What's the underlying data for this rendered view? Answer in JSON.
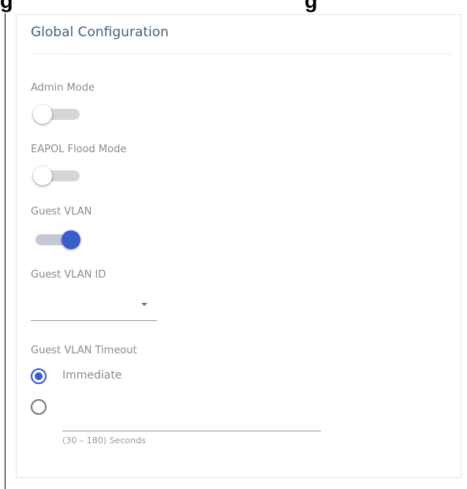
{
  "card": {
    "title": "Global Configuration"
  },
  "admin_mode": {
    "label": "Admin Mode",
    "state": "off"
  },
  "eapol_flood_mode": {
    "label": "EAPOL Flood Mode",
    "state": "off"
  },
  "guest_vlan": {
    "label": "Guest VLAN",
    "state": "on"
  },
  "guest_vlan_id": {
    "label": "Guest VLAN ID",
    "value": ""
  },
  "guest_vlan_timeout": {
    "label": "Guest VLAN Timeout",
    "options": [
      {
        "label": "Immediate",
        "selected": true
      },
      {
        "label": "",
        "selected": false
      }
    ],
    "input_value": "",
    "hint": "(30 – 180) Seconds"
  },
  "colors": {
    "accent": "#3a5ccc",
    "title": "#4a6082",
    "label": "#8c8c8c"
  }
}
